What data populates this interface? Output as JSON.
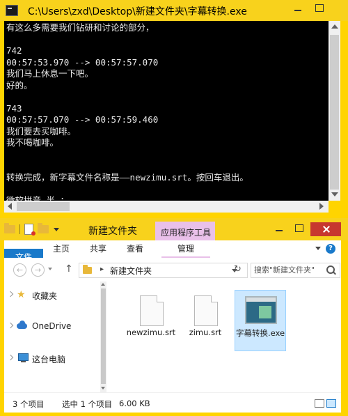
{
  "console": {
    "title": "C:\\Users\\zxd\\Desktop\\新建文件夹\\字幕转换.exe",
    "output": "有这么多需要我们钻研和讨论的部分，\n\n742\n00:57:53.970 --> 00:57:57.070\n我们马上休息一下吧。\n好的。\n\n743\n00:57:57.070 --> 00:57:59.460\n我们要去买咖啡。\n我不喝咖啡。\n\n\n转换完成，新字幕文件名称是——newzimu.srt。按回车退出。\n\n微软拼音 半 ："
  },
  "explorer": {
    "title": "新建文件夹",
    "context_tab": "应用程序工具",
    "ribbon_tabs": {
      "file": "文件",
      "home": "主页",
      "share": "共享",
      "view": "查看",
      "manage": "管理"
    },
    "help": "?",
    "nav": {
      "back": "←",
      "forward": "→",
      "up": "↑",
      "refresh": "↻"
    },
    "address": {
      "separator": "▸",
      "crumb": "新建文件夹"
    },
    "search": {
      "placeholder": "搜索\"新建文件夹\""
    },
    "sidebar": {
      "items": [
        {
          "label": "收藏夹",
          "icon": "star-icon"
        },
        {
          "label": "OneDrive",
          "icon": "cloud-icon"
        },
        {
          "label": "这台电脑",
          "icon": "computer-icon"
        }
      ]
    },
    "files": [
      {
        "name": "newzimu.srt",
        "icon": "document-icon"
      },
      {
        "name": "zimu.srt",
        "icon": "document-icon"
      },
      {
        "name": "字幕转换.exe",
        "icon": "application-icon"
      }
    ],
    "status": {
      "count": "3 个项目",
      "selected": "选中 1 个项目",
      "size": "6.00 KB"
    }
  },
  "colors": {
    "accent": "#1979ca",
    "window_frame": "#f8d21c",
    "context_tab": "#e9c0e9",
    "close_button": "#c7372f",
    "selection": "#cce8ff"
  }
}
